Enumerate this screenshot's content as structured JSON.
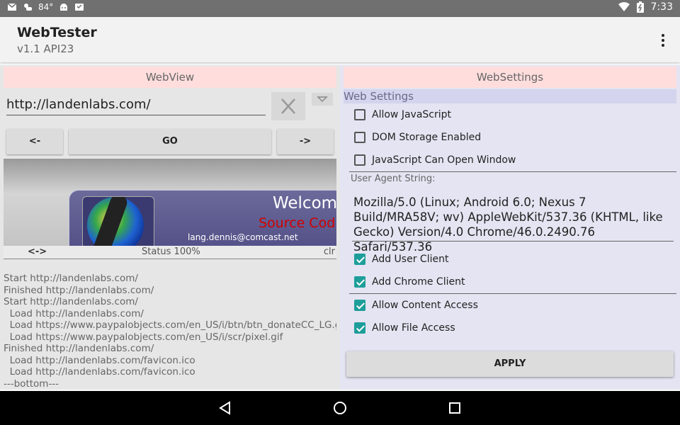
{
  "status_bar": {
    "temperature": "84°",
    "time": "7:33",
    "icons": [
      "gmail-icon",
      "weather-icon",
      "android-icon",
      "inbox-icon",
      "wifi-icon",
      "battery-icon"
    ]
  },
  "app_bar": {
    "title": "WebTester",
    "subtitle": "v1.1 API23",
    "menu_icon": "more-vert-icon"
  },
  "left_pane": {
    "header": "WebView",
    "url_value": "http://landenlabs.com/",
    "clear_icon": "close-icon",
    "dropdown_icon": "triangle-down-icon",
    "back_label": "<-",
    "go_label": "GO",
    "forward_label": "->",
    "webview_content": {
      "welcome": "Welcome",
      "source": "Source Cod",
      "email": "lang.dennis@comcast.net"
    },
    "status": {
      "left": "<->",
      "center": "Status 100%",
      "right": "clr"
    },
    "log_lines": [
      "Start http://landenlabs.com/",
      "Finished http://landenlabs.com/",
      "Start http://landenlabs.com/",
      "  Load http://landenlabs.com/",
      "  Load https://www.paypalobjects.com/en_US/i/btn/btn_donateCC_LG.gif",
      "  Load https://www.paypalobjects.com/en_US/i/scr/pixel.gif",
      "Finished http://landenlabs.com/",
      "  Load http://landenlabs.com/favicon.ico",
      "  Load http://landenlabs.com/favicon.ico",
      "---bottom---"
    ]
  },
  "right_pane": {
    "header": "WebSettings",
    "section_title": "Web Settings",
    "checkboxes_top": [
      {
        "label": "Allow JavaScript",
        "checked": false
      },
      {
        "label": "DOM Storage Enabled",
        "checked": false
      },
      {
        "label": "JavaScript Can Open Window",
        "checked": false
      }
    ],
    "ua_label": "User Agent String:",
    "ua_value": "Mozilla/5.0 (Linux; Android 6.0; Nexus 7 Build/MRA58V; wv) AppleWebKit/537.36 (KHTML, like Gecko) Version/4.0 Chrome/46.0.2490.76 Safari/537.36",
    "checkboxes_clients": [
      {
        "label": "Add User Client",
        "checked": true
      },
      {
        "label": "Add Chrome Client",
        "checked": true
      }
    ],
    "checkboxes_access": [
      {
        "label": "Allow Content Access",
        "checked": true
      },
      {
        "label": "Allow File Access",
        "checked": true
      }
    ],
    "apply_label": "APPLY"
  },
  "nav_bar": {
    "icons": [
      "back-icon",
      "home-icon",
      "recents-icon"
    ]
  },
  "colors": {
    "accent": "#1e9e9a",
    "pane_header": "#ffdddd",
    "settings_bg": "#e4e4f2"
  }
}
